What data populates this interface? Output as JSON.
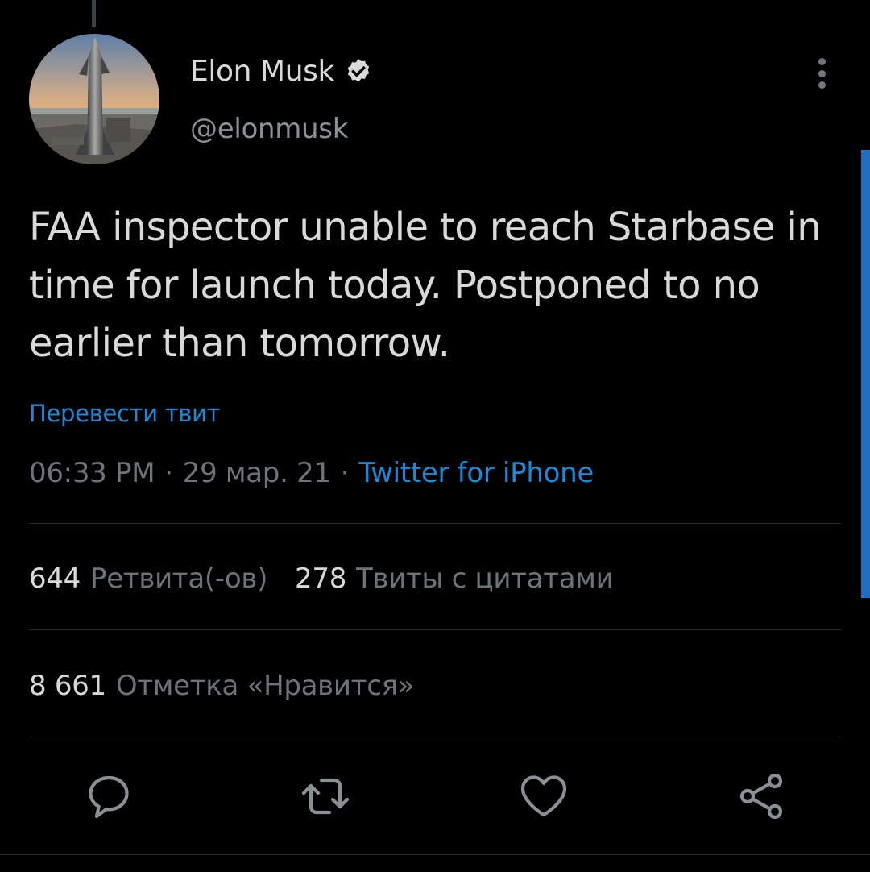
{
  "tweet": {
    "author": {
      "display_name": "Elon Musk",
      "handle": "@elonmusk",
      "verified": true
    },
    "text": "FAA inspector unable to reach Starbase in time for launch today. Postponed to no earlier than tomorrow.",
    "translate_label": "Перевести твит",
    "time": "06:33 PM",
    "date": "29 мар. 21",
    "separator": "·",
    "source": "Twitter for iPhone"
  },
  "stats": {
    "retweets": {
      "value": "644",
      "label": "Ретвита(-ов)"
    },
    "quotes": {
      "value": "278",
      "label": "Твиты с цитатами"
    },
    "likes": {
      "value": "8 661",
      "label": "Отметка «Нравится»"
    }
  },
  "icons": {
    "menu": "more-vertical-icon",
    "verified": "verified-badge-icon",
    "actions": [
      "reply-icon",
      "retweet-icon",
      "like-icon",
      "share-icon"
    ]
  },
  "colors": {
    "background": "#000000",
    "text_primary": "#d9d9d9",
    "text_secondary": "#6e737a",
    "link": "#1f88d6",
    "scrollbar": "#1f6fc4"
  }
}
